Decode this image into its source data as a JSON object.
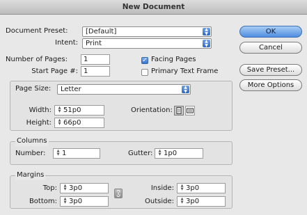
{
  "window": {
    "title": "New Document"
  },
  "document_preset": {
    "label": "Document Preset:",
    "value": "[Default]"
  },
  "intent": {
    "label": "Intent:",
    "value": "Print"
  },
  "pages": {
    "number_label": "Number of Pages:",
    "number_value": "1",
    "start_label": "Start Page #:",
    "start_value": "1",
    "facing_label": "Facing Pages",
    "facing_checked": true,
    "primary_label": "Primary Text Frame",
    "primary_checked": false
  },
  "page_size": {
    "label": "Page Size:",
    "value": "Letter",
    "width_label": "Width:",
    "width_value": "51p0",
    "height_label": "Height:",
    "height_value": "66p0",
    "orientation_label": "Orientation:"
  },
  "columns": {
    "legend": "Columns",
    "number_label": "Number:",
    "number_value": "1",
    "gutter_label": "Gutter:",
    "gutter_value": "1p0"
  },
  "margins": {
    "legend": "Margins",
    "top_label": "Top:",
    "top_value": "3p0",
    "bottom_label": "Bottom:",
    "bottom_value": "3p0",
    "inside_label": "Inside:",
    "inside_value": "3p0",
    "outside_label": "Outside:",
    "outside_value": "3p0"
  },
  "buttons": {
    "ok": "OK",
    "cancel": "Cancel",
    "save_preset": "Save Preset...",
    "more_options": "More Options"
  },
  "icons": {
    "select_arrow": "updown-arrows-icon",
    "stepper": "stepper-icon",
    "portrait": "portrait-orientation-icon",
    "landscape": "landscape-orientation-icon",
    "link": "chain-link-icon"
  },
  "colors": {
    "accent": "#4f8ee0",
    "dialog_bg": "#e8e8e8"
  }
}
